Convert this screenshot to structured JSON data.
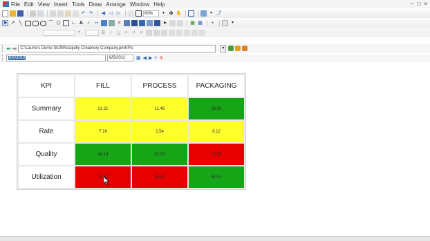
{
  "menu": [
    "File",
    "Edit",
    "View",
    "Insert",
    "Tools",
    "Draw",
    "Arrange",
    "Window",
    "Help"
  ],
  "toolbar": {
    "zoom": "60%"
  },
  "address": {
    "path": "C:\\Laurie's Demo Stuff\\Rosquilly Creamery Company.pmKPIs"
  },
  "dates": {
    "start": "6/6/2010",
    "end": "6/5/2011"
  },
  "kpi_table": {
    "corner": "KPI",
    "columns": [
      "FILL",
      "PROCESS",
      "PACKAGING"
    ],
    "rows": [
      {
        "label": "Summary",
        "values": [
          "21.21",
          "11.46",
          "38.50"
        ],
        "status": [
          "yellow",
          "yellow",
          "green"
        ]
      },
      {
        "label": "Rate",
        "values": [
          "7.16",
          "2.54",
          "9.12"
        ],
        "status": [
          "yellow",
          "yellow",
          "yellow"
        ]
      },
      {
        "label": "Quality",
        "values": [
          "48.19",
          "52.00",
          "70.90"
        ],
        "status": [
          "green",
          "green",
          "red"
        ]
      },
      {
        "label": "Utilization",
        "values": [
          "70.59",
          "36.43",
          "91.81"
        ],
        "status": [
          "red",
          "red",
          "green"
        ]
      }
    ]
  },
  "colors": {
    "red": "#e60000",
    "yellow": "#ffff2e",
    "green": "#16a516"
  },
  "icons": [
    "new-icon",
    "open-icon",
    "save-icon",
    "print-icon",
    "cut-icon",
    "copy-icon",
    "paste-icon",
    "undo-icon",
    "redo-icon",
    "zoom-icon",
    "pointer-icon",
    "text-icon",
    "line-icon",
    "rectangle-icon",
    "ellipse-icon",
    "back-icon",
    "forward-icon",
    "refresh-icon",
    "cursor-icon"
  ]
}
